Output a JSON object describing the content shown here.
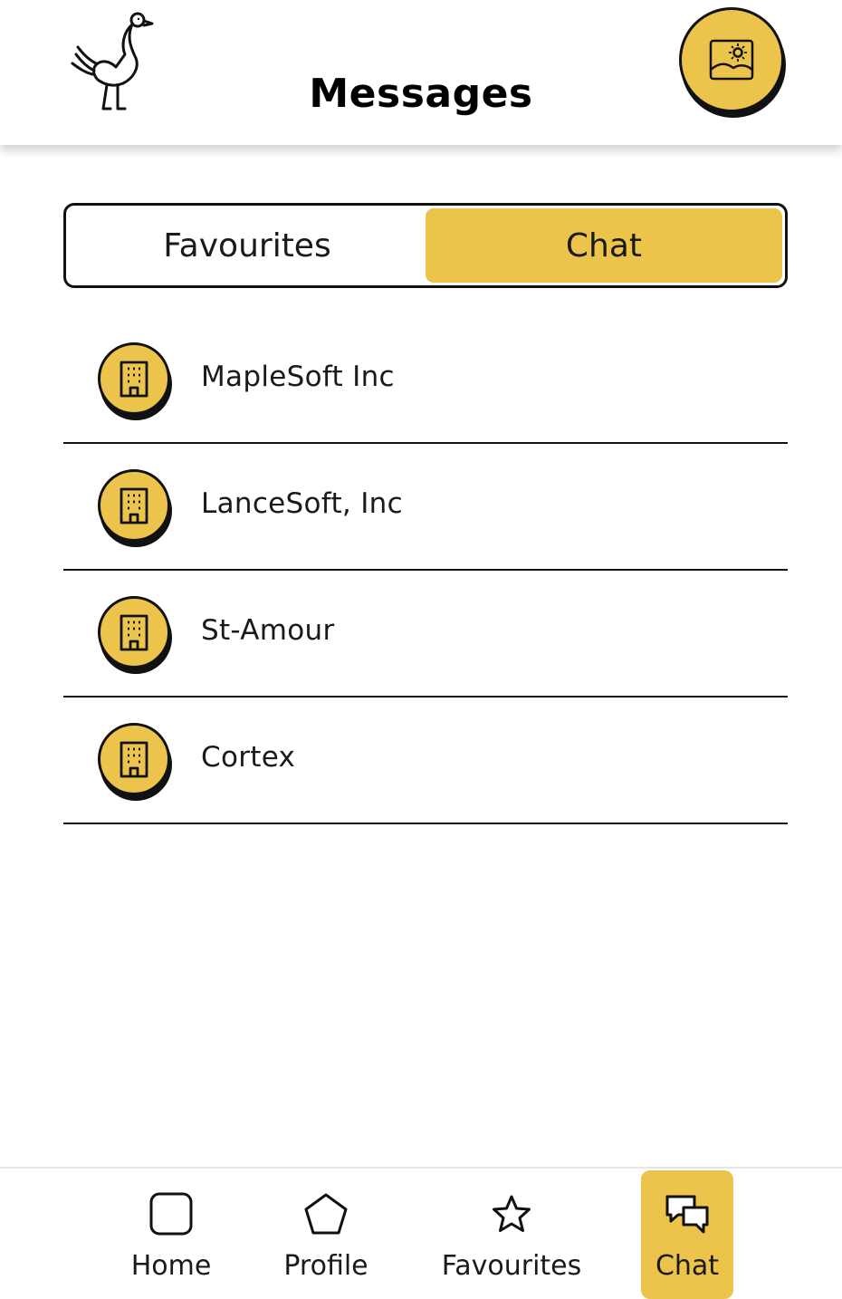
{
  "header": {
    "title": "Messages",
    "logo_icon": "ostrich-logo-icon",
    "profile_picture_icon": "image-placeholder-icon"
  },
  "tabs": [
    {
      "label": "Favourites",
      "active": false
    },
    {
      "label": "Chat",
      "active": true
    }
  ],
  "chats": [
    {
      "name": "MapleSoft Inc",
      "icon": "building-icon"
    },
    {
      "name": "LanceSoft, Inc",
      "icon": "building-icon"
    },
    {
      "name": "St-Amour",
      "icon": "building-icon"
    },
    {
      "name": "Cortex",
      "icon": "building-icon"
    }
  ],
  "bottom_nav": [
    {
      "label": "Home",
      "icon": "square-icon",
      "active": false
    },
    {
      "label": "Profile",
      "icon": "pentagon-icon",
      "active": false
    },
    {
      "label": "Favourites",
      "icon": "star-icon",
      "active": false
    },
    {
      "label": "Chat",
      "icon": "chat-bubbles-icon",
      "active": true
    }
  ],
  "colors": {
    "accent": "#ecc44b",
    "outline": "#111111",
    "background": "#ffffff"
  }
}
